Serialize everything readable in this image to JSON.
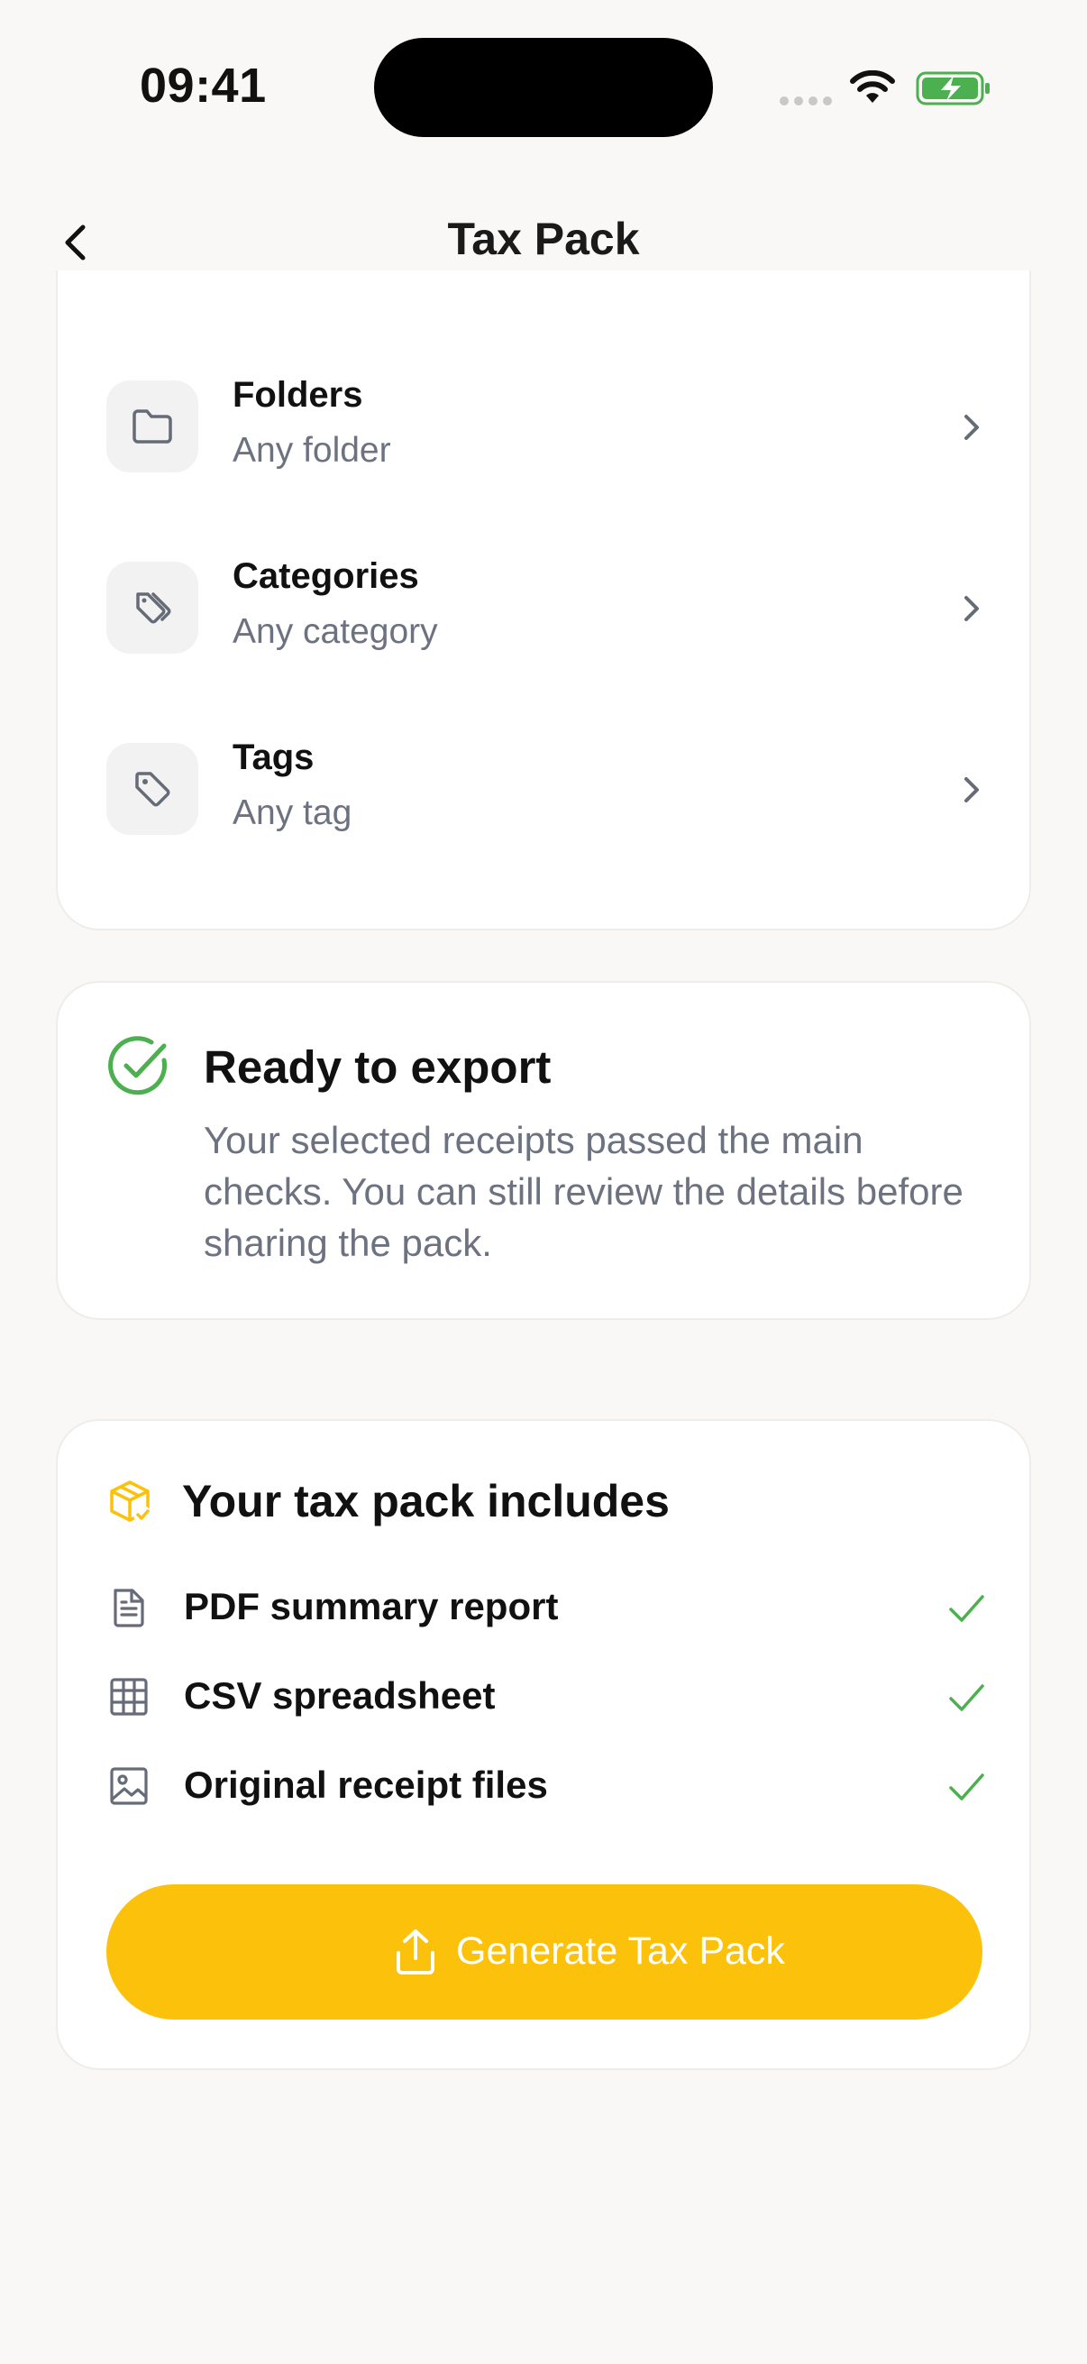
{
  "status_bar": {
    "time": "09:41"
  },
  "nav": {
    "title": "Tax Pack"
  },
  "filters": [
    {
      "icon": "folder-icon",
      "title": "Folders",
      "subtitle": "Any folder"
    },
    {
      "icon": "tags-icon",
      "title": "Categories",
      "subtitle": "Any category"
    },
    {
      "icon": "tag-icon",
      "title": "Tags",
      "subtitle": "Any tag"
    }
  ],
  "ready": {
    "icon": "check-circle-icon",
    "title": "Ready to export",
    "body": "Your selected receipts passed the main checks. You can still review the details before sharing the pack."
  },
  "pack": {
    "icon": "package-check-icon",
    "title": "Your tax pack includes",
    "items": [
      {
        "icon": "file-text-icon",
        "label": "PDF summary report",
        "included": true
      },
      {
        "icon": "table-icon",
        "label": "CSV spreadsheet",
        "included": true
      },
      {
        "icon": "image-icon",
        "label": "Original receipt files",
        "included": true
      }
    ],
    "button_label": "Generate Tax Pack"
  },
  "colors": {
    "accent": "#fcc20b",
    "success": "#4caf50",
    "muted_text": "#6d7281",
    "background": "#f9f8f6"
  }
}
